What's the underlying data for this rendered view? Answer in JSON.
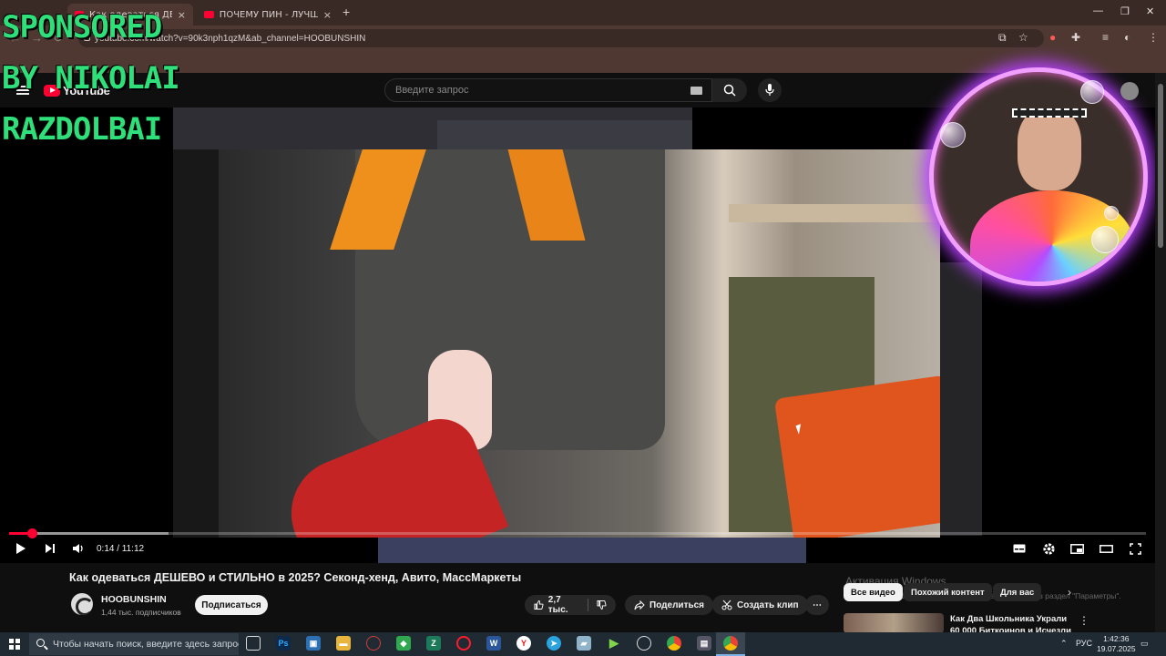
{
  "browser": {
    "tabs": [
      {
        "label": "Как одеваться ДЕШЕВО и СТИ..."
      },
      {
        "label": "ПОЧЕМУ ПИН - ЛУЧШИЙ СМ..."
      }
    ],
    "new_tab_symbol": "+",
    "url": "youtube.com/watch?v=90k3nph1qzM&ab_channel=HOOBUNSHIN"
  },
  "overlay": {
    "sponsor_lines": [
      "SPONSORED",
      "BY NIKOLAI",
      "RAZDOLBAI"
    ],
    "accent_color": "#2fe07a",
    "cam_ring_color": "#b640ff"
  },
  "youtube": {
    "logo_text": "YouTube",
    "region": "RU",
    "search_placeholder": "Введите запрос",
    "icons": [
      "menu-icon",
      "search-icon",
      "keyboard-icon",
      "mic-icon",
      "avatar-icon"
    ]
  },
  "player": {
    "time": "0:14 / 11:12",
    "progress_fraction": 0.02,
    "buffered_fraction": 0.14,
    "progress_color": "#ff0033"
  },
  "video": {
    "title": "Как одеваться ДЕШЕВО и СТИЛЬНО в 2025? Секонд-хенд, Авито, МассМаркеты",
    "channel": "HOOBUNSHIN",
    "subscribers": "1,44 тыс. подписчиков",
    "subscribe_label": "Подписаться",
    "likes": "2,7 тыс.",
    "share_label": "Поделиться",
    "clip_label": "Создать клип",
    "more_symbol": "⋯"
  },
  "sidebar": {
    "chips": [
      "Все видео",
      "Похожий контент",
      "Для вас"
    ],
    "recommendation_title": "Как Два Школьника Украли 60 000 Биткоинов и Исчезли"
  },
  "watermark": {
    "line1": "Активация Windows",
    "line2": "Чтобы активировать Windows, перейдите в раздел \"Параметры\"."
  },
  "taskbar": {
    "search_placeholder": "Чтобы начать поиск, введите здесь запрос",
    "lang": "РУС",
    "time": "1:42:36",
    "date": "19.07.2025"
  }
}
